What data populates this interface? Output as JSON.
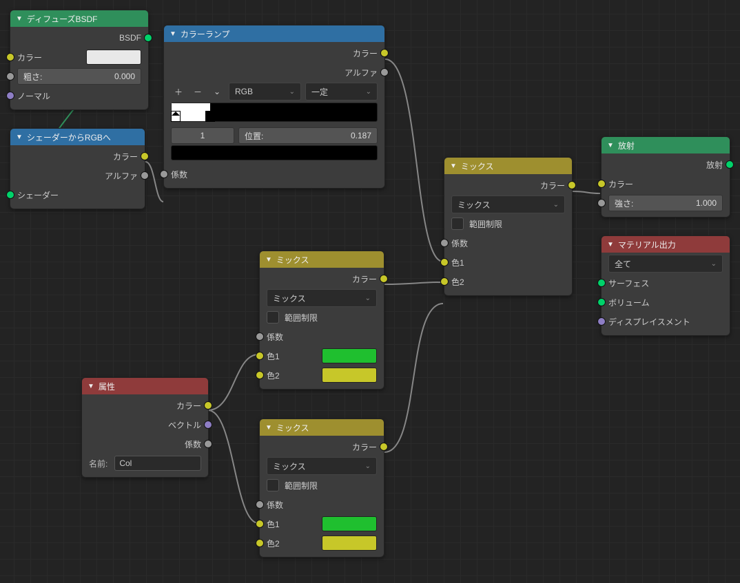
{
  "common": {
    "color": "カラー",
    "alpha": "アルファ",
    "factor": "係数",
    "mix": "ミックス",
    "clamp": "範囲制限",
    "color1": "色1",
    "color2": "色2",
    "normal": "ノーマル"
  },
  "nodes": {
    "diffuse": {
      "title": "ディフューズBSDF",
      "out": "BSDF",
      "roughness_label": "粗さ:",
      "roughness_value": "0.000"
    },
    "shader_to_rgb": {
      "title": "シェーダーからRGBへ",
      "shader": "シェーダー"
    },
    "color_ramp": {
      "title": "カラーランプ",
      "mode": "RGB",
      "interp": "一定",
      "stop_index": "1",
      "pos_label": "位置:",
      "pos_value": "0.187"
    },
    "attribute": {
      "title": "属性",
      "vector": "ベクトル",
      "name_label": "名前:",
      "name_value": "Col"
    },
    "emission": {
      "title": "放射",
      "out": "放射",
      "strength_label": "強さ:",
      "strength_value": "1.000"
    },
    "material_output": {
      "title": "マテリアル出力",
      "target": "全て",
      "surface": "サーフェス",
      "volume": "ボリューム",
      "displacement": "ディスプレイスメント"
    }
  }
}
